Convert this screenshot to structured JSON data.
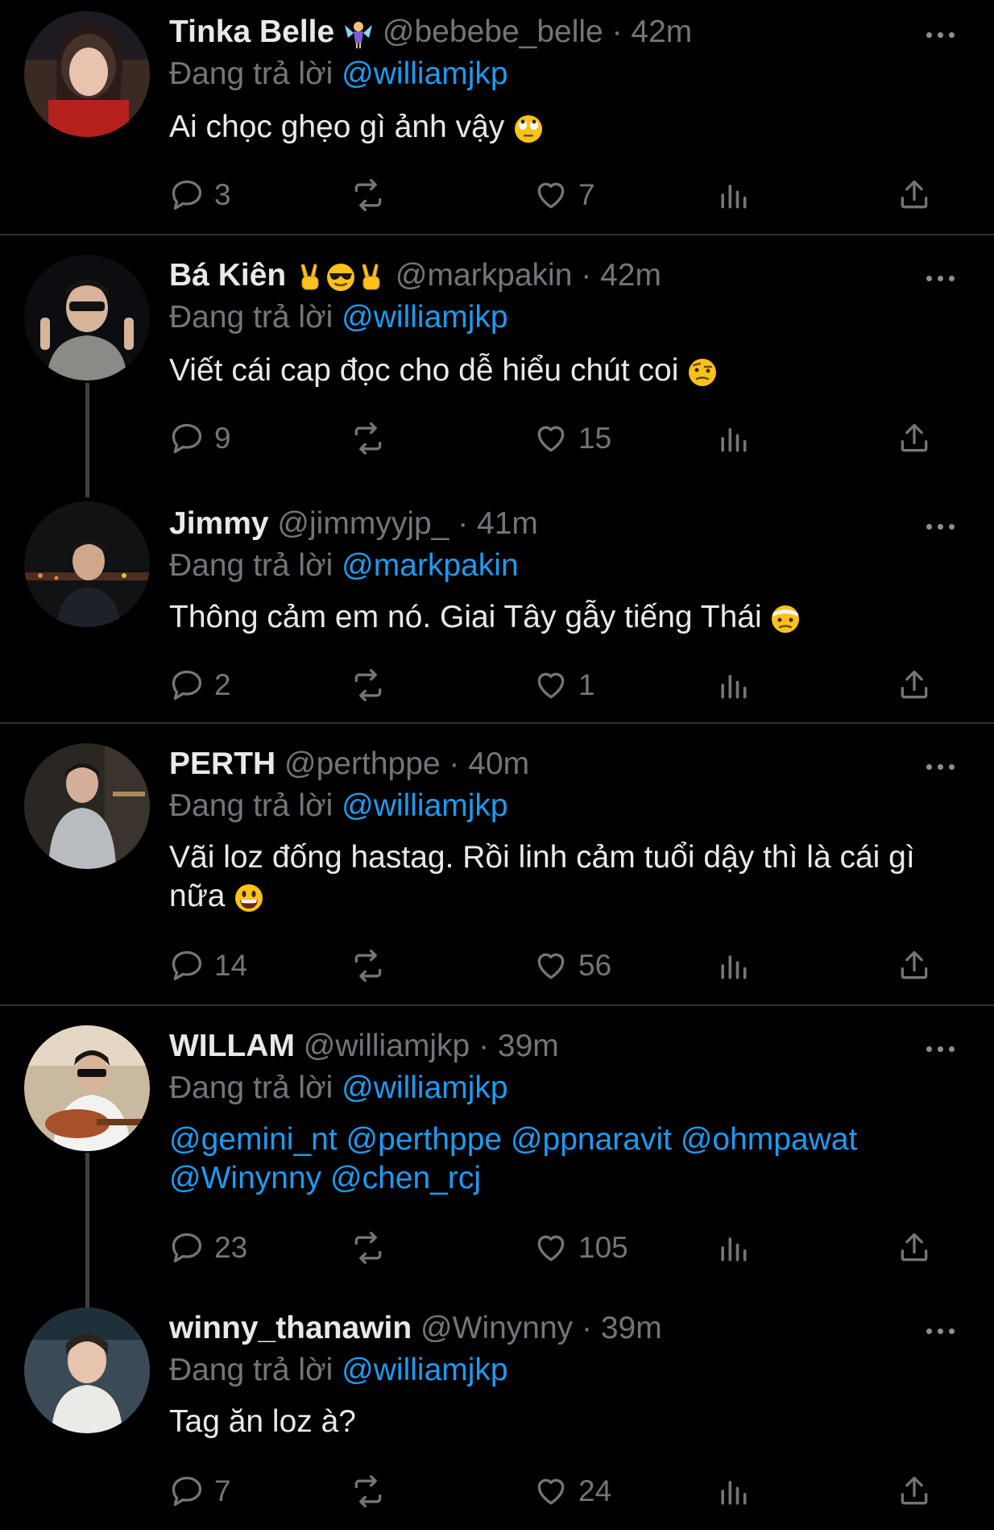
{
  "reply_prefix": "Đang trả lời",
  "tweets": [
    {
      "name": "Tinka Belle",
      "name_emoji": "fairy-emoji",
      "handle": "@bebebe_belle",
      "time": "42m",
      "replying_to": "@williamjkp",
      "text": "Ai chọc ghẹo gì ảnh vậy",
      "text_emoji": "eye-roll-emoji",
      "replies": "3",
      "retweets": "",
      "likes": "7"
    },
    {
      "name": "Bá Kiên",
      "name_emoji": "victory-sunglasses-victory-emoji",
      "handle": "@markpakin",
      "time": "42m",
      "replying_to": "@williamjkp",
      "text": "Viết cái cap đọc cho dễ hiểu chút coi",
      "text_emoji": "raised-eyebrow-emoji",
      "replies": "9",
      "retweets": "",
      "likes": "15"
    },
    {
      "name": "Jimmy",
      "handle": "@jimmyyjp_",
      "time": "41m",
      "replying_to": "@markpakin",
      "text": "Thông cảm em nó. Giai Tây gẫy tiếng Thái",
      "text_emoji": "injured-face-emoji",
      "replies": "2",
      "retweets": "",
      "likes": "1"
    },
    {
      "name": "PERTH",
      "handle": "@perthppe",
      "time": "40m",
      "replying_to": "@williamjkp",
      "text_line1": "Vãi loz đống hastag. Rồi linh cảm tuổi dậy thì là cái gì",
      "text_line2": "nữa",
      "text_emoji": "grinning-emoji",
      "replies": "14",
      "retweets": "",
      "likes": "56"
    },
    {
      "name": "WILLAM",
      "handle": "@williamjkp",
      "time": "39m",
      "replying_to": "@williamjkp",
      "mentions_line1": [
        "@gemini_nt",
        "@perthppe",
        "@ppnaravit",
        "@ohmpawat"
      ],
      "mentions_line2": [
        "@Winynny",
        "@chen_rcj"
      ],
      "replies": "23",
      "retweets": "",
      "likes": "105"
    },
    {
      "name": "winny_thanawin",
      "handle": "@Winynny",
      "time": "39m",
      "replying_to": "@williamjkp",
      "text": "Tag ăn loz à?",
      "replies": "7",
      "retweets": "",
      "likes": "24"
    }
  ],
  "colors": {
    "background": "#000000",
    "text": "#e7e9ea",
    "muted": "#71767b",
    "link": "#1d9bf0",
    "divider": "#2f3336"
  }
}
